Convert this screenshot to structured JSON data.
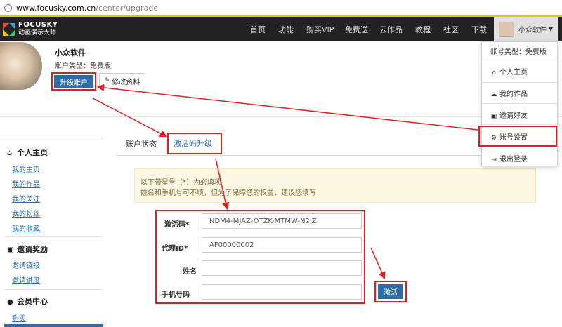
{
  "address_bar": {
    "host": "www.focusky.com.cn",
    "path": "/center/upgrade"
  },
  "logo": {
    "en": "FOCUSKY",
    "cn": "动画演示大师"
  },
  "nav": {
    "items": [
      "首页",
      "功能",
      "购买VIP",
      "免费送",
      "云作品",
      "教程",
      "社区",
      "下载"
    ],
    "user_name": "小众软件"
  },
  "dropdown": {
    "account_type": "账号类型：免费版",
    "items": [
      {
        "label": "个人主页",
        "icon": "home-icon"
      },
      {
        "label": "我的作品",
        "icon": "cloud-icon"
      },
      {
        "label": "邀请好友",
        "icon": "invite-icon"
      },
      {
        "label": "账号设置",
        "icon": "gear-icon"
      },
      {
        "label": "退出登录",
        "icon": "logout-icon"
      }
    ]
  },
  "profile": {
    "name": "小众软件",
    "account_type": "账户类型：免费版",
    "upgrade_label": "升级账户",
    "edit_label": "修改资料"
  },
  "sidebar": {
    "sections": [
      {
        "title": "个人主页",
        "icon": "home-icon",
        "links": [
          "我的主页",
          "我的作品",
          "我的关注",
          "我的粉丝",
          "我的收藏"
        ]
      },
      {
        "title": "邀请奖励",
        "icon": "invite-icon",
        "links": [
          "邀请链接",
          "邀请进度"
        ]
      },
      {
        "title": "会员中心",
        "icon": "user-icon",
        "links": [
          "购买"
        ]
      }
    ]
  },
  "tabs": [
    "账户状态",
    "激活码升级"
  ],
  "notice": {
    "line1": "以下带星号（*）为必填项",
    "line2": "姓名和手机号可不填，但为了保障您的权益，建议您填写"
  },
  "form": {
    "fields": [
      {
        "label": "激活码*",
        "value": "NDM4-MJAZ-OTZK-MTMW-N2IZ"
      },
      {
        "label": "代理ID*",
        "value": "AF00000002"
      },
      {
        "label": "姓名",
        "value": ""
      },
      {
        "label": "手机号码",
        "value": ""
      }
    ],
    "submit_label": "激活"
  },
  "colors": {
    "nav_bg": "#222222",
    "primary": "#2e6da4",
    "highlight": "#e02020",
    "notice_bg": "#fcf8e3"
  }
}
